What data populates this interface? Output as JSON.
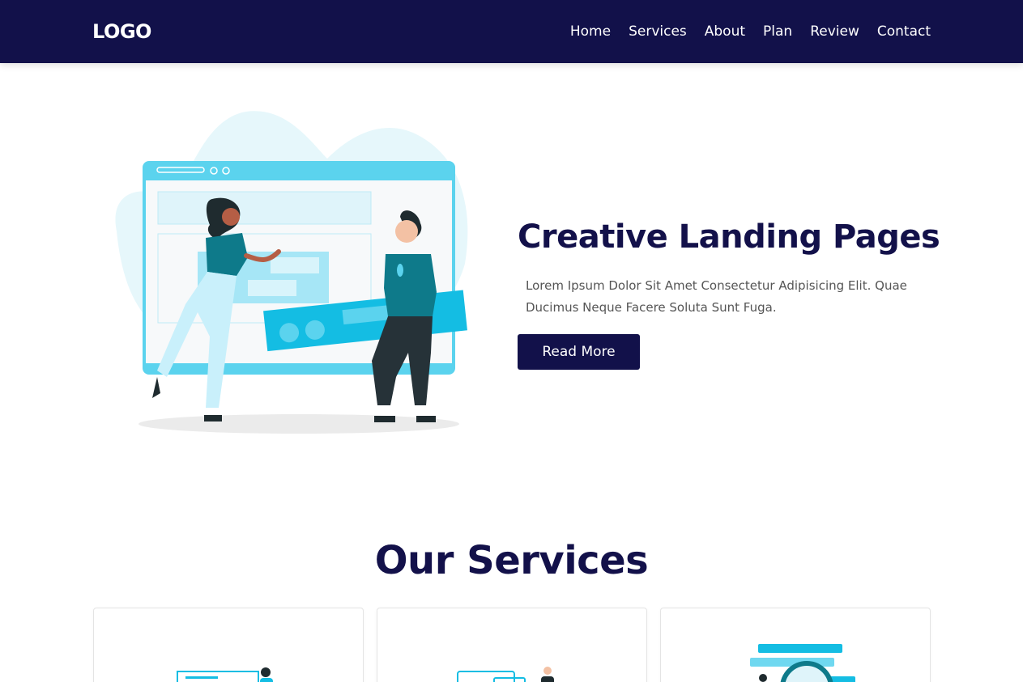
{
  "header": {
    "logo": "LOGO",
    "nav": [
      "Home",
      "Services",
      "About",
      "Plan",
      "Review",
      "Contact"
    ]
  },
  "hero": {
    "title": "Creative Landing Pages",
    "text": "Lorem Ipsum Dolor Sit Amet Consectetur Adipisicing Elit. Quae Ducimus Neque Facere Soluta Sunt Fuga.",
    "button": "Read More",
    "illustration": "people-building-webpage-illustration"
  },
  "services": {
    "heading_prefix": "Our",
    "heading_highlight": "Services",
    "cards": [
      {
        "icon": "web-design-illustration"
      },
      {
        "icon": "devices-illustration"
      },
      {
        "icon": "search-magnifier-illustration"
      }
    ]
  },
  "colors": {
    "navy": "#12114a",
    "accent": "#1ec1ea",
    "light_blue": "#5bd3ee",
    "text_gray": "#555555"
  }
}
